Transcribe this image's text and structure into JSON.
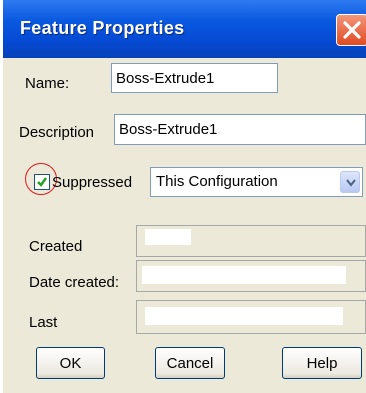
{
  "window": {
    "title": "Feature Properties"
  },
  "fields": {
    "name_label": "Name:",
    "name_value": "Boss-Extrude1",
    "description_label": "Description",
    "description_value": "Boss-Extrude1",
    "suppressed_label": "Suppressed",
    "suppressed_checked": true,
    "configuration_value": "This Configuration",
    "created_label": "Created",
    "date_created_label": "Date created:",
    "last_label": "Last"
  },
  "buttons": {
    "ok": "OK",
    "cancel": "Cancel",
    "help": "Help"
  },
  "colors": {
    "titlebar": "#0a59e0",
    "highlight_circle": "#e0191e",
    "window_bg": "#ece9d8"
  }
}
